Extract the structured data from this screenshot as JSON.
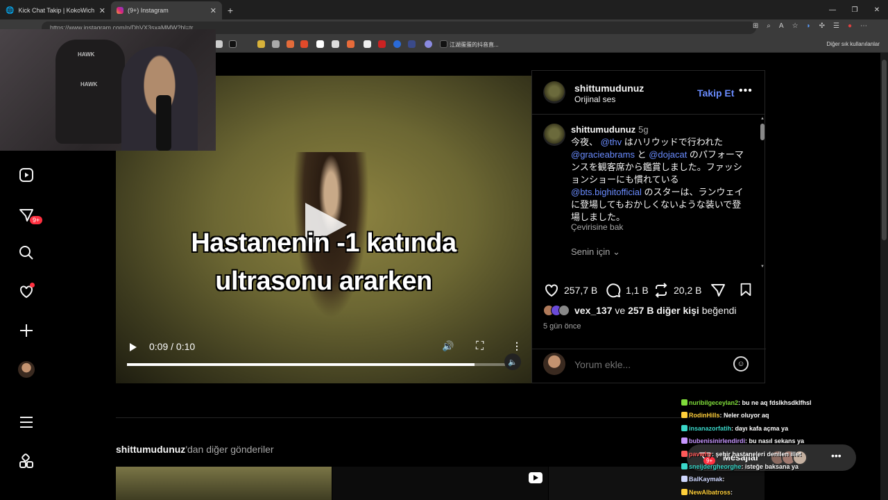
{
  "browser": {
    "tabs": [
      {
        "title": "Kick Chat Takip | KokoWich",
        "active": false
      },
      {
        "title": "(9+) Instagram",
        "active": true
      }
    ],
    "url": "https://www.instagram.com/p/DhVX3sxaMMW?hl=tr",
    "bookmark_text": "江湖蛋蛋的抖音直...",
    "other_bookmarks": "Diğer sık kullanılanlar"
  },
  "webcam": {
    "logo_top": "HAWK",
    "logo_chair": "HAWK"
  },
  "sidebar": {
    "messages_badge": "9+"
  },
  "video": {
    "overlay_line1": "Hastanenin -1 katında",
    "overlay_line2": "ultrasonu ararken",
    "time": "0:09 / 0:10",
    "progress": 0.92
  },
  "post": {
    "author": "shittumudunuz",
    "audio": "Orijinal ses",
    "follow_label": "Takip Et",
    "caption_time": "5g",
    "caption_parts": [
      {
        "text": "今夜、 ",
        "mention": false
      },
      {
        "text": "@thv",
        "mention": true
      },
      {
        "text": " はハリウッドで行われた ",
        "mention": false
      },
      {
        "text": "@gracieabrams",
        "mention": true
      },
      {
        "text": " と ",
        "mention": false
      },
      {
        "text": "@dojacat",
        "mention": true
      },
      {
        "text": " のパフォーマンスを観客席から鑑賞しました。ファッションショーにも慣れている ",
        "mention": false
      },
      {
        "text": "@bts.bighitofficial",
        "mention": true
      },
      {
        "text": " のスターは、ランウェイに登場してもおかしくないような装いで登場しました。",
        "mention": false
      }
    ],
    "translate_label": "Çevirisine bak",
    "for_you_label": "Senin için",
    "likes_count": "257,7 B",
    "comments_count": "1,1 B",
    "reposts_count": "20,2 B",
    "liked_by_user": "vex_137",
    "liked_by_joiner": " ve ",
    "liked_by_others": "257 B diğer kişi",
    "liked_suffix": " beğendi",
    "posted_ago": "5 gün önce",
    "comment_placeholder": "Yorum ekle..."
  },
  "more_posts": {
    "author": "shittumudunuz",
    "suffix": "'dan diğer gönderiler"
  },
  "chat": [
    {
      "user": "nuribilgeceylan2",
      "message": "bu ne aq fdslkhsdklfhsl",
      "color": "#7fdc3a"
    },
    {
      "user": "RodinHills",
      "message": "Neler oluyor aq",
      "color": "#ffcf3a"
    },
    {
      "user": "insanazorfatih",
      "message": "dayı kafa açma ya",
      "color": "#3ad7c9"
    },
    {
      "user": "bubenisinirlendirdi",
      "message": "bu nasıl sekans ya",
      "color": "#c796ff"
    },
    {
      "user": "pavwhy",
      "message": "şehir hastaneleri denilen illet",
      "color": "#ff5a5a"
    },
    {
      "user": "sneijdergheorghe",
      "message": "isteğe baksana ya",
      "color": "#3ad7c9"
    },
    {
      "user": "BalKaymak",
      "message": "",
      "color": "#cfd8ff"
    },
    {
      "user": "NewAlbatross",
      "message": "",
      "color": "#ffcf3a"
    }
  ],
  "messages_bar": {
    "label": "Mesajlar",
    "badge": "9+"
  },
  "colors": {
    "accent": "#6a8cff",
    "badge": "#ff3040",
    "background": "#000000"
  }
}
